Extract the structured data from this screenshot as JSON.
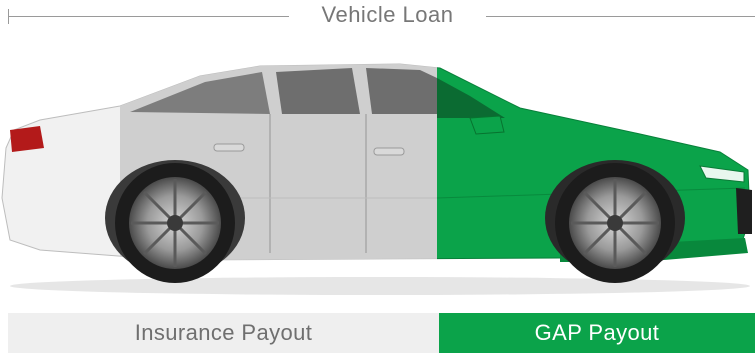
{
  "header": {
    "title": "Vehicle Loan"
  },
  "payouts": {
    "insurance_label": "Insurance Payout",
    "gap_label": "GAP Payout"
  },
  "colors": {
    "insurance_bg": "#efefef",
    "gap_green": "#0ba34a",
    "car_white": "#f1f1f1",
    "car_grey": "#cfcfcf"
  },
  "image": {
    "icon": "car-sedan-icon"
  }
}
